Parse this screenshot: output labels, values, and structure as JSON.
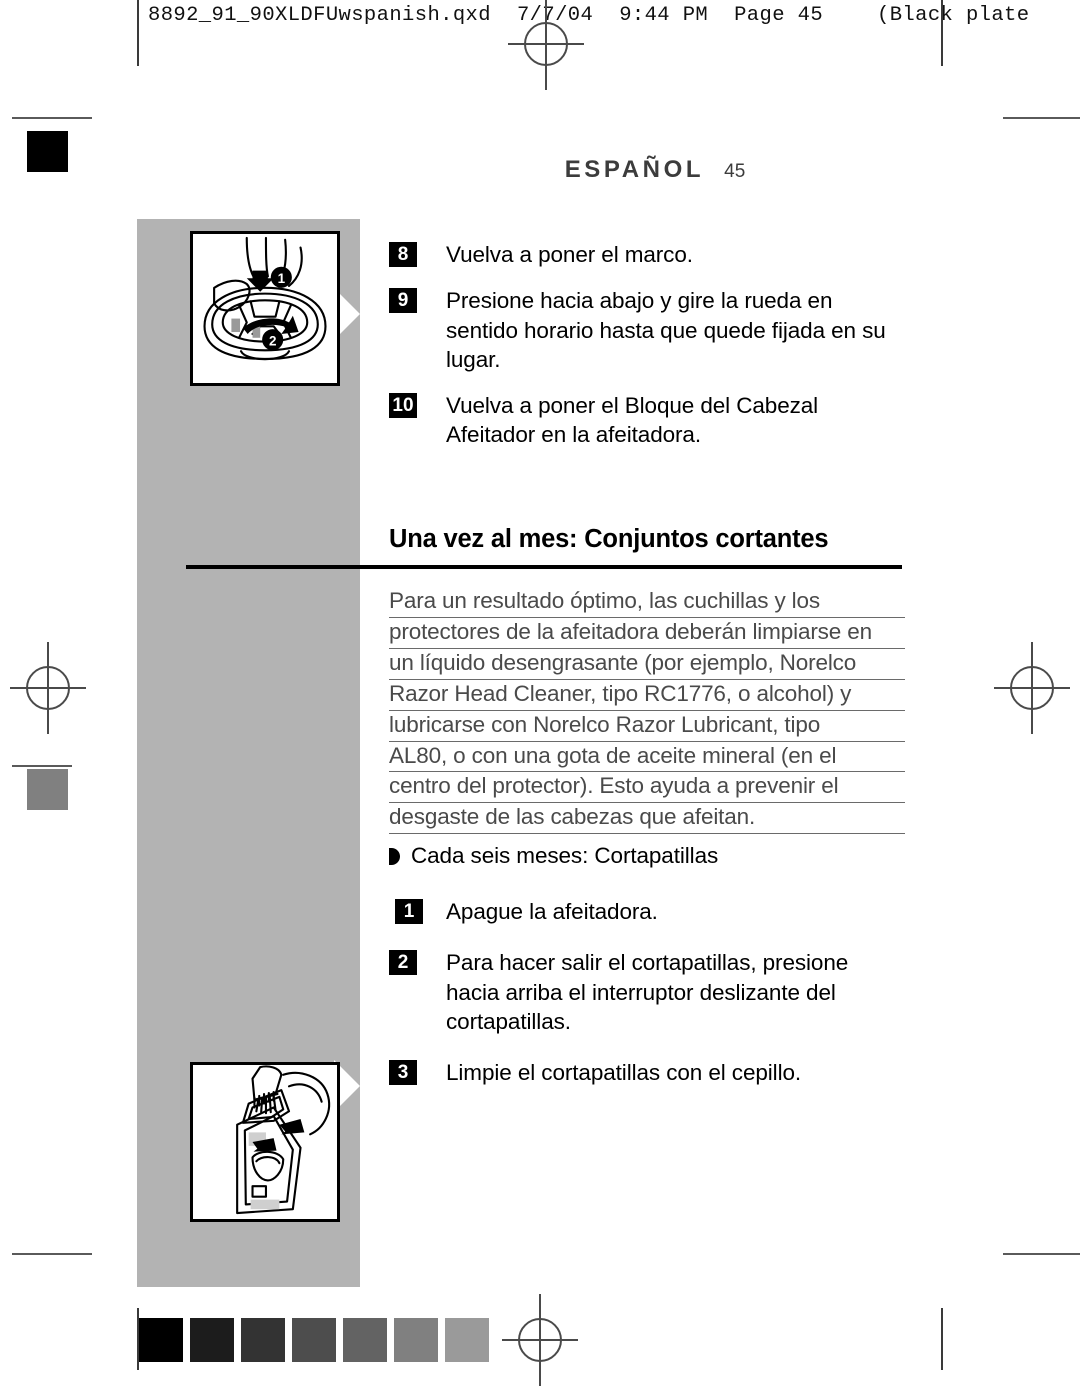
{
  "slug": {
    "filename": "8892_91_90XLDFUwspanish.qxd",
    "date": "7/7/04",
    "time": "9:44 PM",
    "page_label": "Page 45",
    "plate": "(Black plate"
  },
  "header": {
    "language_title": "ESPAÑOL",
    "page_number": "45"
  },
  "steps_top": [
    {
      "number": "8",
      "text": "Vuelva a poner el marco."
    },
    {
      "number": "9",
      "text": "Presione hacia abajo y gire la rueda en sentido horario hasta que quede fijada en su lugar."
    },
    {
      "number": "10",
      "text": "Vuelva a poner el Bloque del Cabezal Afeitador en la afeitadora."
    }
  ],
  "section": {
    "heading": "Una vez al mes: Conjuntos cortantes",
    "paragraph_lines": [
      "Para un resultado óptimo, las cuchillas y los ",
      "protectores de la afeitadora deberán limpiarse en ",
      "un líquido desengrasante (por ejemplo, Norelco ",
      "Razor Head Cleaner, tipo RC1776, o alcohol) y ",
      "lubricarse con Norelco Razor Lubricant, tipo ",
      "AL80, o con una gota de aceite mineral (en el ",
      "centro del protector). Esto ayuda a prevenir el ",
      "desgaste de las cabezas que afeitan."
    ]
  },
  "subsection": {
    "bullet_label": "Cada seis meses: Cortapatillas",
    "bullet_icon": "half-disc-bullet-icon"
  },
  "steps_bottom": [
    {
      "number": "1",
      "text": "Apague la afeitadora."
    },
    {
      "number": "2",
      "text": "Para hacer salir el cortapatillas, presione hacia arriba el interruptor deslizante del cortapatillas."
    },
    {
      "number": "3",
      "text": "Limpie el cortapatillas con el cepillo."
    }
  ],
  "figures": [
    {
      "name": "shaver-head-wheel-illustration",
      "caption_refs": "9",
      "arrow_labels": [
        "1",
        "2"
      ]
    },
    {
      "name": "trimmer-brush-cleaning-illustration",
      "caption_refs": "3",
      "arrow_labels": []
    }
  ],
  "print_marks": {
    "calibration_swatches_left": [
      "#000000",
      "#1c1c1c",
      "#333333",
      "#4d4d4d",
      "#636363",
      "#808080",
      "#9a9a9a"
    ],
    "calibration_swatches_right": [
      "#b0b0b0",
      "#cbcbcb",
      "#e8e8e8"
    ],
    "band_color": "#b3b3b3",
    "registration_mark": "registration-crosshair-icon"
  }
}
